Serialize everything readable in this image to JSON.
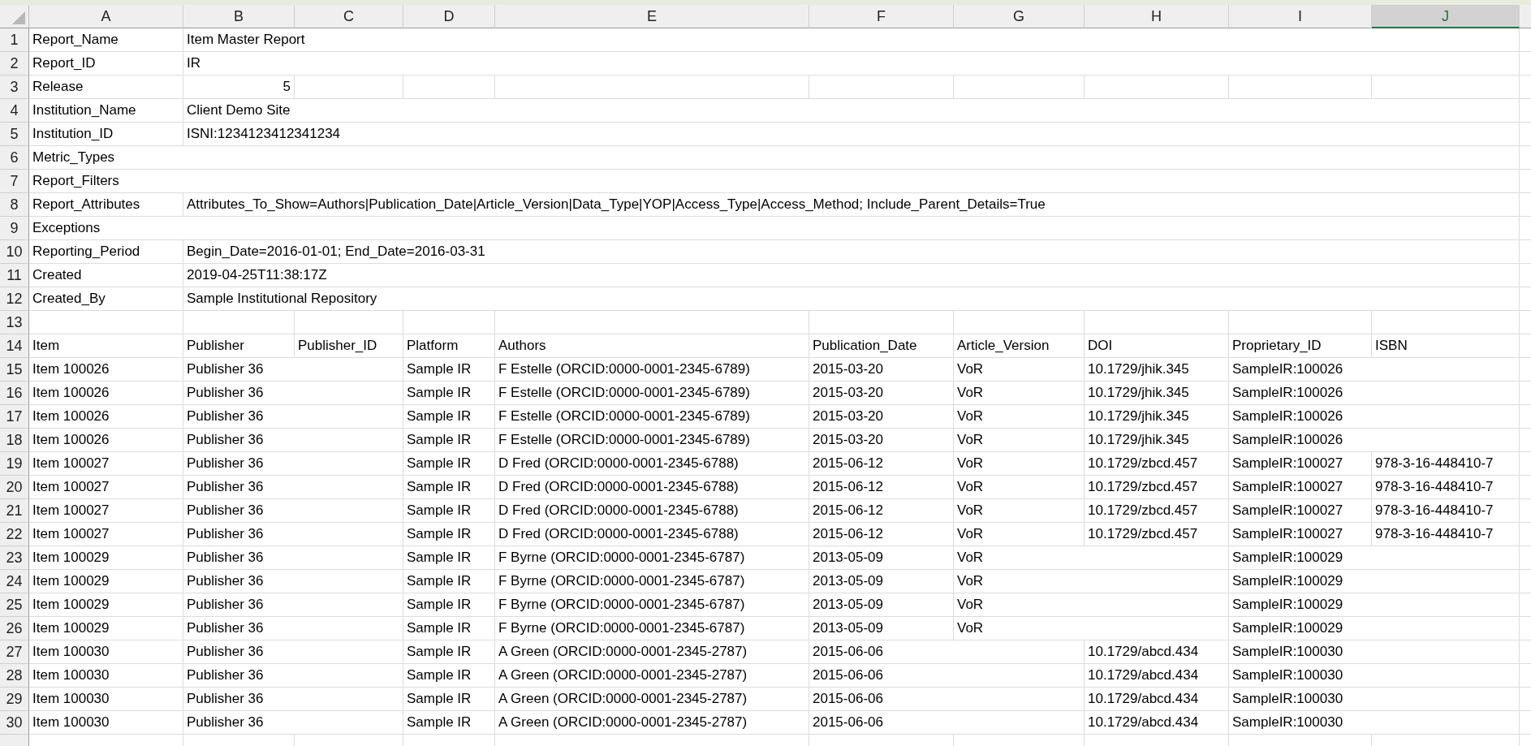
{
  "columns": [
    {
      "label": "A",
      "selected": false
    },
    {
      "label": "B",
      "selected": false
    },
    {
      "label": "C",
      "selected": false
    },
    {
      "label": "D",
      "selected": false
    },
    {
      "label": "E",
      "selected": false
    },
    {
      "label": "F",
      "selected": false
    },
    {
      "label": "G",
      "selected": false
    },
    {
      "label": "H",
      "selected": false
    },
    {
      "label": "I",
      "selected": false
    },
    {
      "label": "J",
      "selected": true
    }
  ],
  "rows": [
    {
      "number": "1",
      "cells": {
        "A": "Report_Name",
        "B": "Item Master Report"
      }
    },
    {
      "number": "2",
      "cells": {
        "A": "Report_ID",
        "B": "IR"
      }
    },
    {
      "number": "3",
      "cells": {
        "A": "Release",
        "B": {
          "text": "5",
          "kind": "number"
        }
      }
    },
    {
      "number": "4",
      "cells": {
        "A": "Institution_Name",
        "B": "Client Demo Site"
      }
    },
    {
      "number": "5",
      "cells": {
        "A": "Institution_ID",
        "B": "ISNI:1234123412341234"
      }
    },
    {
      "number": "6",
      "cells": {
        "A": "Metric_Types"
      }
    },
    {
      "number": "7",
      "cells": {
        "A": "Report_Filters"
      }
    },
    {
      "number": "8",
      "cells": {
        "A": "Report_Attributes",
        "B": "Attributes_To_Show=Authors|Publication_Date|Article_Version|Data_Type|YOP|Access_Type|Access_Method; Include_Parent_Details=True"
      }
    },
    {
      "number": "9",
      "cells": {
        "A": "Exceptions"
      }
    },
    {
      "number": "10",
      "cells": {
        "A": "Reporting_Period",
        "B": "Begin_Date=2016-01-01; End_Date=2016-03-31"
      }
    },
    {
      "number": "11",
      "cells": {
        "A": "Created",
        "B": "2019-04-25T11:38:17Z"
      }
    },
    {
      "number": "12",
      "cells": {
        "A": "Created_By",
        "B": "Sample Institutional Repository"
      }
    },
    {
      "number": "13",
      "cells": {}
    },
    {
      "number": "14",
      "cells": {
        "A": "Item",
        "B": "Publisher",
        "C": "Publisher_ID",
        "D": "Platform",
        "E": "Authors",
        "F": "Publication_Date",
        "G": "Article_Version",
        "H": "DOI",
        "I": "Proprietary_ID",
        "J": "ISBN"
      }
    },
    {
      "number": "15",
      "cells": {
        "A": "Item 100026",
        "B": "Publisher 36",
        "D": "Sample IR",
        "E": "F Estelle (ORCID:0000-0001-2345-6789)",
        "F": "2015-03-20",
        "G": "VoR",
        "H": "10.1729/jhik.345",
        "I": "SampleIR:100026"
      }
    },
    {
      "number": "16",
      "cells": {
        "A": "Item 100026",
        "B": "Publisher 36",
        "D": "Sample IR",
        "E": "F Estelle (ORCID:0000-0001-2345-6789)",
        "F": "2015-03-20",
        "G": "VoR",
        "H": "10.1729/jhik.345",
        "I": "SampleIR:100026"
      }
    },
    {
      "number": "17",
      "cells": {
        "A": "Item 100026",
        "B": "Publisher 36",
        "D": "Sample IR",
        "E": "F Estelle (ORCID:0000-0001-2345-6789)",
        "F": "2015-03-20",
        "G": "VoR",
        "H": "10.1729/jhik.345",
        "I": "SampleIR:100026"
      }
    },
    {
      "number": "18",
      "cells": {
        "A": "Item 100026",
        "B": "Publisher 36",
        "D": "Sample IR",
        "E": "F Estelle (ORCID:0000-0001-2345-6789)",
        "F": "2015-03-20",
        "G": "VoR",
        "H": "10.1729/jhik.345",
        "I": "SampleIR:100026"
      }
    },
    {
      "number": "19",
      "cells": {
        "A": "Item 100027",
        "B": "Publisher 36",
        "D": "Sample IR",
        "E": "D Fred (ORCID:0000-0001-2345-6788)",
        "F": "2015-06-12",
        "G": "VoR",
        "H": "10.1729/zbcd.457",
        "I": "SampleIR:100027",
        "J": "978-3-16-448410-7"
      }
    },
    {
      "number": "20",
      "cells": {
        "A": "Item 100027",
        "B": "Publisher 36",
        "D": "Sample IR",
        "E": "D Fred (ORCID:0000-0001-2345-6788)",
        "F": "2015-06-12",
        "G": "VoR",
        "H": "10.1729/zbcd.457",
        "I": "SampleIR:100027",
        "J": "978-3-16-448410-7"
      }
    },
    {
      "number": "21",
      "cells": {
        "A": "Item 100027",
        "B": "Publisher 36",
        "D": "Sample IR",
        "E": "D Fred (ORCID:0000-0001-2345-6788)",
        "F": "2015-06-12",
        "G": "VoR",
        "H": "10.1729/zbcd.457",
        "I": "SampleIR:100027",
        "J": "978-3-16-448410-7"
      }
    },
    {
      "number": "22",
      "cells": {
        "A": "Item 100027",
        "B": "Publisher 36",
        "D": "Sample IR",
        "E": "D Fred (ORCID:0000-0001-2345-6788)",
        "F": "2015-06-12",
        "G": "VoR",
        "H": "10.1729/zbcd.457",
        "I": "SampleIR:100027",
        "J": "978-3-16-448410-7"
      }
    },
    {
      "number": "23",
      "cells": {
        "A": "Item 100029",
        "B": "Publisher 36",
        "D": "Sample IR",
        "E": "F Byrne (ORCID:0000-0001-2345-6787)",
        "F": "2013-05-09",
        "G": "VoR",
        "I": "SampleIR:100029"
      }
    },
    {
      "number": "24",
      "cells": {
        "A": "Item 100029",
        "B": "Publisher 36",
        "D": "Sample IR",
        "E": "F Byrne (ORCID:0000-0001-2345-6787)",
        "F": "2013-05-09",
        "G": "VoR",
        "I": "SampleIR:100029"
      }
    },
    {
      "number": "25",
      "cells": {
        "A": "Item 100029",
        "B": "Publisher 36",
        "D": "Sample IR",
        "E": "F Byrne (ORCID:0000-0001-2345-6787)",
        "F": "2013-05-09",
        "G": "VoR",
        "I": "SampleIR:100029"
      }
    },
    {
      "number": "26",
      "cells": {
        "A": "Item 100029",
        "B": "Publisher 36",
        "D": "Sample IR",
        "E": "F Byrne (ORCID:0000-0001-2345-6787)",
        "F": "2013-05-09",
        "G": "VoR",
        "I": "SampleIR:100029"
      }
    },
    {
      "number": "27",
      "cells": {
        "A": "Item 100030",
        "B": "Publisher 36",
        "D": "Sample IR",
        "E": "A Green (ORCID:0000-0001-2345-2787)",
        "F": "2015-06-06",
        "H": "10.1729/abcd.434",
        "I": "SampleIR:100030"
      }
    },
    {
      "number": "28",
      "cells": {
        "A": "Item 100030",
        "B": "Publisher 36",
        "D": "Sample IR",
        "E": "A Green (ORCID:0000-0001-2345-2787)",
        "F": "2015-06-06",
        "H": "10.1729/abcd.434",
        "I": "SampleIR:100030"
      }
    },
    {
      "number": "29",
      "cells": {
        "A": "Item 100030",
        "B": "Publisher 36",
        "D": "Sample IR",
        "E": "A Green (ORCID:0000-0001-2345-2787)",
        "F": "2015-06-06",
        "H": "10.1729/abcd.434",
        "I": "SampleIR:100030"
      }
    },
    {
      "number": "30",
      "cells": {
        "A": "Item 100030",
        "B": "Publisher 36",
        "D": "Sample IR",
        "E": "A Green (ORCID:0000-0001-2345-2787)",
        "F": "2015-06-06",
        "H": "10.1729/abcd.434",
        "I": "SampleIR:100030"
      }
    }
  ]
}
